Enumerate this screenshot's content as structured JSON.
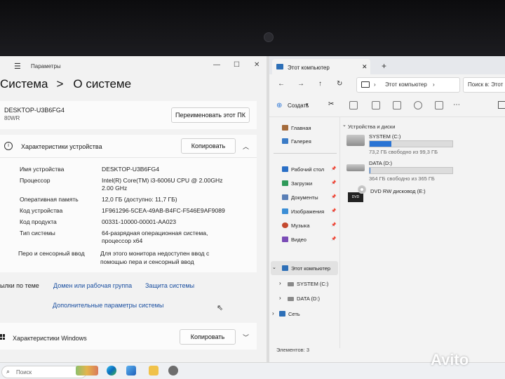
{
  "settings": {
    "window_title": "Параметры",
    "heading_section": "Система",
    "heading_page": "О системе",
    "pc_name": "DESKTOP-U3B6FG4",
    "pc_model": "80WR",
    "rename_button": "Переименовать этот ПК",
    "device_specs": {
      "title": "Характеристики устройства",
      "copy_button": "Копировать",
      "rows": [
        {
          "label": "Имя устройства",
          "value": "DESKTOP-U3B6FG4"
        },
        {
          "label": "Процессор",
          "value": "Intel(R) Core(TM) i3-6006U CPU @ 2.00GHz",
          "value2": "2.00 GHz"
        },
        {
          "label": "Оперативная память",
          "value": "12,0 ГБ (доступно: 11,7 ГБ)"
        },
        {
          "label": "Код устройства",
          "value": "1F961296-5CEA-49AB-B4FC-F546E9AF9089"
        },
        {
          "label": "Код продукта",
          "value": "00331-10000-00001-AA023"
        },
        {
          "label": "Тип системы",
          "value": "64-разрядная операционная система,",
          "value2": "процессор x64"
        },
        {
          "label": "Перо и сенсорный ввод",
          "value": "Для этого монитора недоступен ввод с",
          "value2": "помощью пера и сенсорный ввод"
        }
      ]
    },
    "related_links": {
      "prefix": "ылки по теме",
      "domain": "Домен или рабочая группа",
      "protection": "Защита системы",
      "advanced": "Дополнительные параметры системы"
    },
    "windows_specs": {
      "title": "Характеристики Windows",
      "copy_button": "Копировать"
    }
  },
  "explorer": {
    "tab_title": "Этот компьютер",
    "address": "Этот компьютер",
    "search_placeholder": "Поиск в: Этот",
    "create_button": "Создать",
    "nav": {
      "home": "Главная",
      "gallery": "Галерея",
      "desktop": "Рабочий стол",
      "downloads": "Загрузки",
      "documents": "Документы",
      "images": "Изображения",
      "music": "Музыка",
      "video": "Видео",
      "this_pc": "Этот компьютер",
      "system": "SYSTEM (C:)",
      "data": "DATA (D:)",
      "network": "Сеть"
    },
    "section_title": "Устройства и диски",
    "drives": [
      {
        "name": "SYSTEM (C:)",
        "free_text": "73,2 ГБ свободно из 99,3 ГБ",
        "used_fraction": 0.263
      },
      {
        "name": "DATA (D:)",
        "free_text": "364 ГБ свободно из 365 ГБ",
        "used_fraction": 0.003
      },
      {
        "name": "DVD RW дисковод (E:)",
        "free_text": ""
      }
    ],
    "status_bar": "Элементов: 3"
  },
  "taskbar": {
    "search_placeholder": "Поиск"
  },
  "watermark": "Avito",
  "colors": {
    "accent": "#2a74d4",
    "link": "#1a4fa0"
  }
}
